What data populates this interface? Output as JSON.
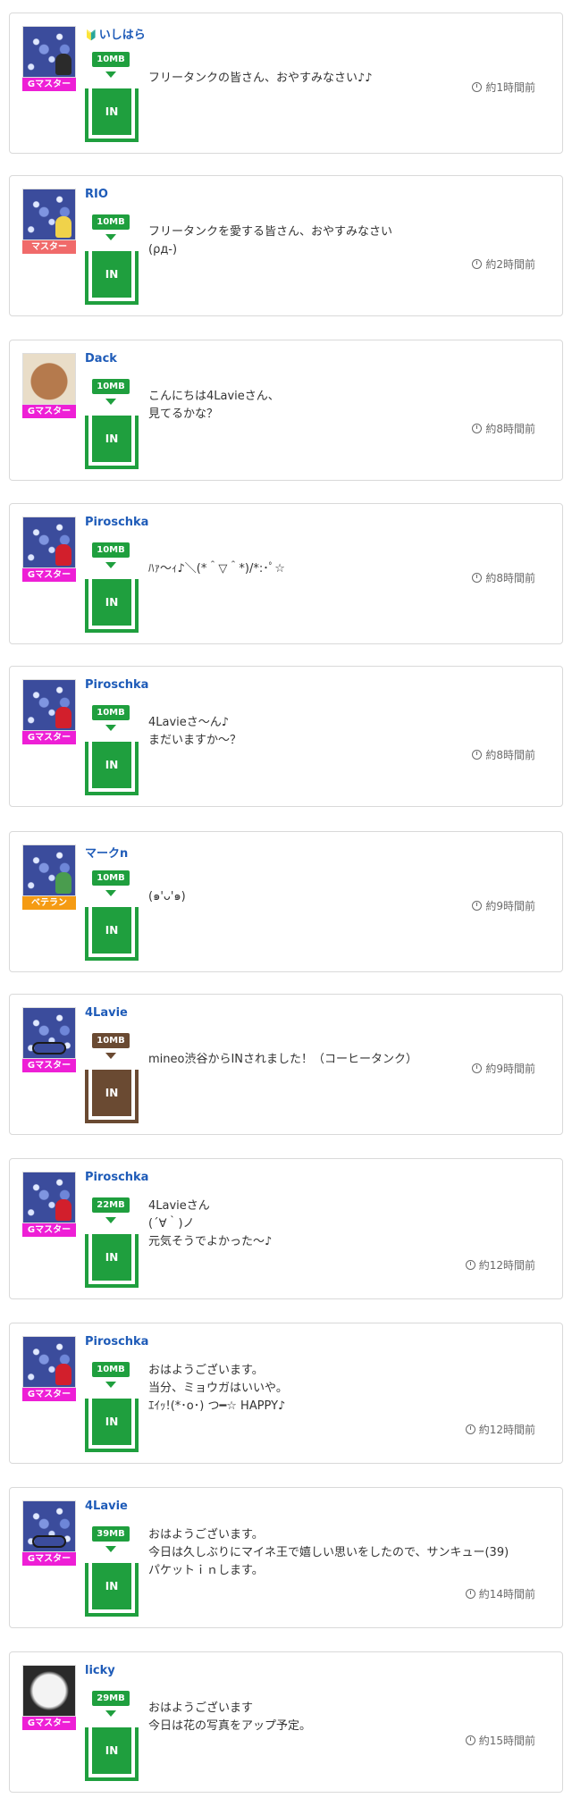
{
  "colors": {
    "tank_green": "#1f9f3e",
    "tank_brown": "#6a4a32",
    "username_blue": "#1e5bb8",
    "rank_gmaster": "#ee1fd6",
    "rank_master": "#f06a6a",
    "rank_veteran": "#f59b13"
  },
  "posts": [
    {
      "user": "いしはら",
      "beginner": true,
      "rank": "Gマスター",
      "rank_color": "#ee1fd6",
      "amount": "10MB",
      "direction": "IN",
      "tank_color": "#1f9f3e",
      "message": [
        "フリータンクの皆さん、おやすみなさい♪♪"
      ],
      "time": "約1時間前",
      "avatar": "av-flowers",
      "figure": "dark"
    },
    {
      "user": "RIO",
      "beginner": false,
      "rank": "マスター",
      "rank_color": "#f06a6a",
      "amount": "10MB",
      "direction": "IN",
      "tank_color": "#1f9f3e",
      "message": [
        "フリータンクを愛する皆さん、おやすみなさい",
        "(ρд-)"
      ],
      "time": "約2時間前",
      "avatar": "av-flowers",
      "figure": "yellow"
    },
    {
      "user": "Dack",
      "beginner": false,
      "rank": "Gマスター",
      "rank_color": "#ee1fd6",
      "amount": "10MB",
      "direction": "IN",
      "tank_color": "#1f9f3e",
      "message": [
        "こんにちは4Lavieさん、",
        "見てるかな？"
      ],
      "time": "約8時間前",
      "avatar": "av-bear",
      "figure": ""
    },
    {
      "user": "Piroschka",
      "beginner": false,
      "rank": "Gマスター",
      "rank_color": "#ee1fd6",
      "amount": "10MB",
      "direction": "IN",
      "tank_color": "#1f9f3e",
      "message": [
        "ﾊｧ〜ｨ♪＼(*＾▽＾*)/*:･ﾟ☆"
      ],
      "time": "約8時間前",
      "avatar": "av-flowers",
      "figure": "red"
    },
    {
      "user": "Piroschka",
      "beginner": false,
      "rank": "Gマスター",
      "rank_color": "#ee1fd6",
      "amount": "10MB",
      "direction": "IN",
      "tank_color": "#1f9f3e",
      "message": [
        "4Lavieさ〜ん♪",
        "まだいますか〜？"
      ],
      "time": "約8時間前",
      "avatar": "av-flowers",
      "figure": "red"
    },
    {
      "user": "マークn",
      "beginner": false,
      "rank": "ベテラン",
      "rank_color": "#f59b13",
      "amount": "10MB",
      "direction": "IN",
      "tank_color": "#1f9f3e",
      "message": [
        "(๑'ᴗ'๑)"
      ],
      "time": "約9時間前",
      "avatar": "av-flowers",
      "figure": "green"
    },
    {
      "user": "4Lavie",
      "beginner": false,
      "rank": "Gマスター",
      "rank_color": "#ee1fd6",
      "amount": "10MB",
      "direction": "IN",
      "tank_color": "#6a4a32",
      "message": [
        "mineo渋谷からINされました！（コーヒータンク）"
      ],
      "time": "約9時間前",
      "avatar": "av-flowers",
      "figure": "bike"
    },
    {
      "user": "Piroschka",
      "beginner": false,
      "rank": "Gマスター",
      "rank_color": "#ee1fd6",
      "amount": "22MB",
      "direction": "IN",
      "tank_color": "#1f9f3e",
      "message": [
        "4Lavieさん",
        "(´∀｀)ノ",
        "元気そうでよかった〜♪"
      ],
      "time": "約12時間前",
      "avatar": "av-flowers",
      "figure": "red"
    },
    {
      "user": "Piroschka",
      "beginner": false,
      "rank": "Gマスター",
      "rank_color": "#ee1fd6",
      "amount": "10MB",
      "direction": "IN",
      "tank_color": "#1f9f3e",
      "message": [
        "おはようございます。",
        "当分、ミョウガはいいや。",
        "ｴｲｯ!(*･o･) つ━☆ HAPPY♪"
      ],
      "time": "約12時間前",
      "avatar": "av-flowers",
      "figure": "red"
    },
    {
      "user": "4Lavie",
      "beginner": false,
      "rank": "Gマスター",
      "rank_color": "#ee1fd6",
      "amount": "39MB",
      "direction": "IN",
      "tank_color": "#1f9f3e",
      "message": [
        "おはようございます。",
        "今日は久しぶりにマイネ王で嬉しい思いをしたので、サンキュー(39)",
        "パケットｉｎします。"
      ],
      "time": "約14時間前",
      "avatar": "av-flowers",
      "figure": "bike"
    },
    {
      "user": "licky",
      "beginner": false,
      "rank": "Gマスター",
      "rank_color": "#ee1fd6",
      "amount": "29MB",
      "direction": "IN",
      "tank_color": "#1f9f3e",
      "message": [
        "おはようございます",
        "今日は花の写真をアップ予定。"
      ],
      "time": "約15時間前",
      "avatar": "av-dog",
      "figure": ""
    }
  ]
}
